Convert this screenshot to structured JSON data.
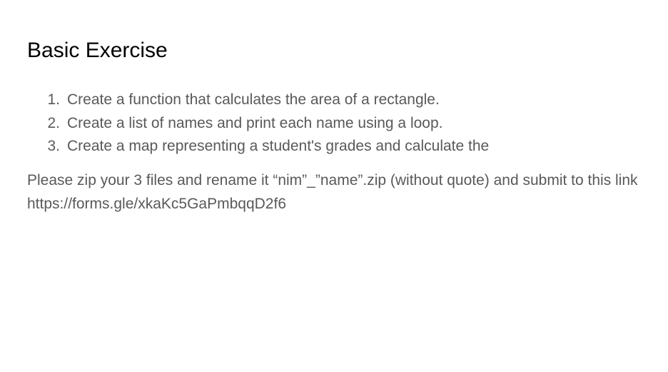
{
  "slide": {
    "title": "Basic Exercise",
    "exercises": [
      {
        "number": "1.",
        "text": "Create a function that calculates the area of a rectangle."
      },
      {
        "number": "2.",
        "text": "Create a list of names and print each name using a loop."
      },
      {
        "number": "3.",
        "text": "Create a map representing a student's grades and calculate the"
      }
    ],
    "instructions": "Please zip your 3 files and rename it “nim”_”name”.zip (without quote) and submit to this link https://forms.gle/xkaKc5GaPmbqqD2f6"
  }
}
